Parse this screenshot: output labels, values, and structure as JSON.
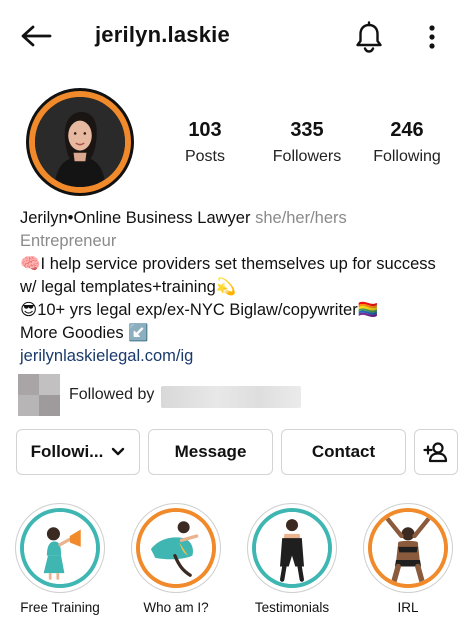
{
  "header": {
    "username": "jerilyn.laskie"
  },
  "profile": {
    "stats": [
      {
        "value": "103",
        "label": "Posts"
      },
      {
        "value": "335",
        "label": "Followers"
      },
      {
        "value": "246",
        "label": "Following"
      }
    ],
    "avatar_ring_color": "#f08a2a"
  },
  "bio": {
    "name": "Jerilyn•Online Business Lawyer",
    "pronouns": "she/her/hers",
    "category": "Entrepreneur",
    "line1": "🧠I help service providers set themselves up for success",
    "line2": "w/ legal templates+training💫",
    "line3": "😎10+ yrs legal exp/ex-NYC Biglaw/copywriter🏳️‍🌈",
    "line4": "More Goodies ↙️",
    "link": "jerilynlaskielegal.com/ig"
  },
  "followed_by": {
    "prefix": "Followed by"
  },
  "actions": {
    "following_label": "Followi...",
    "message_label": "Message",
    "contact_label": "Contact"
  },
  "highlights": [
    {
      "label": "Free Training",
      "ring_color": "#3fb6b2",
      "icon": "megaphone-woman-illustration"
    },
    {
      "label": "Who am I?",
      "ring_color": "#f08a2a",
      "icon": "dancing-woman-illustration"
    },
    {
      "label": "Testimonials",
      "ring_color": "#3fb6b2",
      "icon": "standing-woman-illustration"
    },
    {
      "label": "IRL",
      "ring_color": "#f08a2a",
      "icon": "cheering-woman-illustration"
    }
  ]
}
